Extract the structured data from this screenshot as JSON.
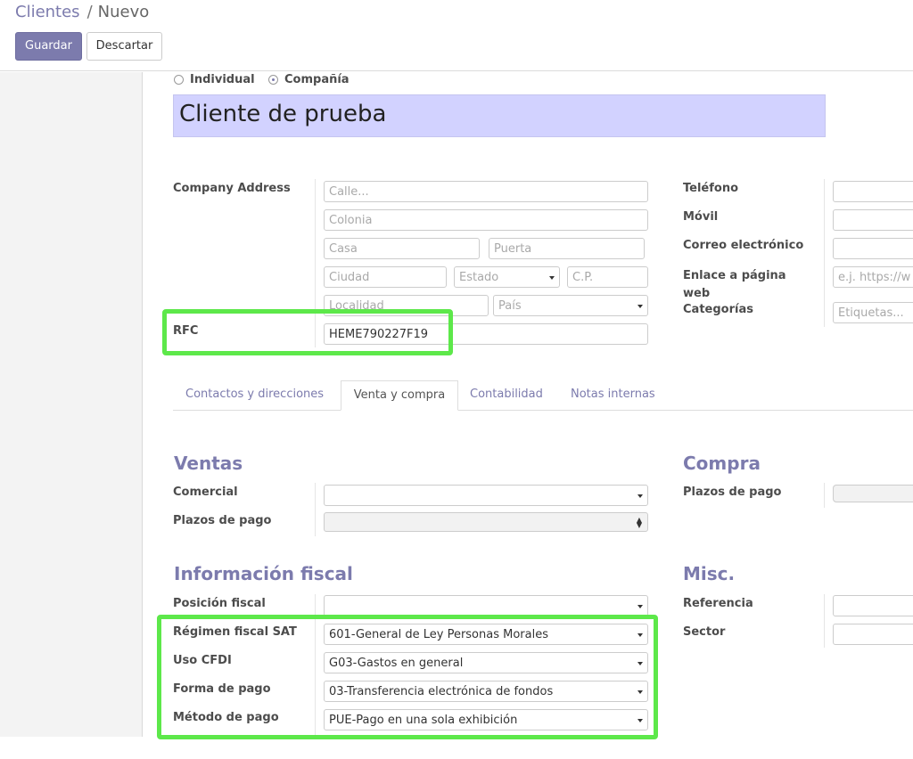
{
  "breadcrumb": {
    "parent": "Clientes",
    "separator": "/",
    "current": "Nuevo"
  },
  "buttons": {
    "save": "Guardar",
    "discard": "Descartar"
  },
  "company_type": {
    "individual": "Individual",
    "company": "Compañía",
    "selected": "company"
  },
  "partner_name": "Cliente de prueba",
  "address": {
    "label": "Company Address",
    "street_ph": "Calle...",
    "colonia_ph": "Colonia",
    "casa_ph": "Casa",
    "puerta_ph": "Puerta",
    "ciudad_ph": "Ciudad",
    "estado_ph": "Estado",
    "cp_ph": "C.P.",
    "localidad_ph": "Localidad",
    "pais_ph": "País"
  },
  "rfc": {
    "label": "RFC",
    "value": "HEME790227F19"
  },
  "contact": {
    "phone_label": "Teléfono",
    "mobile_label": "Móvil",
    "email_label": "Correo electrónico",
    "website_label": "Enlace a página web",
    "website_ph": "e.j. https://w",
    "categories_label": "Categorías",
    "categories_ph": "Etiquetas..."
  },
  "tabs": [
    {
      "label": "Contactos y direcciones",
      "active": false
    },
    {
      "label": "Venta y compra",
      "active": true
    },
    {
      "label": "Contabilidad",
      "active": false
    },
    {
      "label": "Notas internas",
      "active": false
    }
  ],
  "sales": {
    "title": "Ventas",
    "salesperson_label": "Comercial",
    "salesperson_value": "",
    "terms_label": "Plazos de pago",
    "terms_value": ""
  },
  "purchase": {
    "title": "Compra",
    "terms_label": "Plazos de pago"
  },
  "fiscal": {
    "title": "Información fiscal",
    "position_label": "Posición fiscal",
    "position_value": "",
    "regime_label": "Régimen fiscal SAT",
    "regime_value": "601-General de Ley Personas Morales",
    "cfdi_label": "Uso CFDI",
    "cfdi_value": "G03-Gastos en general",
    "payment_form_label": "Forma de pago",
    "payment_form_value": "03-Transferencia electrónica de fondos",
    "payment_method_label": "Método de pago",
    "payment_method_value": "PUE-Pago en una sola exhibición"
  },
  "misc": {
    "title": "Misc.",
    "ref_label": "Referencia",
    "sector_label": "Sector"
  },
  "colors": {
    "accent": "#7c7bad",
    "highlight": "#5de84a",
    "name_bg": "#d2d2ff"
  }
}
